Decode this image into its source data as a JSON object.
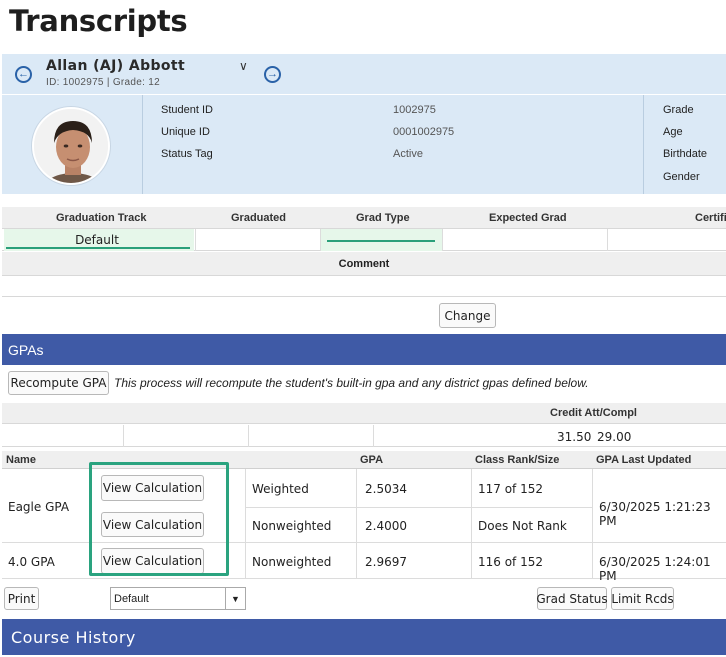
{
  "page_title": "Transcripts",
  "student": {
    "name": "Allan (AJ) Abbott",
    "sub": "ID: 1002975 |  Grade: 12",
    "fields_left": [
      {
        "label": "Student ID",
        "value": "1002975"
      },
      {
        "label": "Unique ID",
        "value": "0001002975"
      },
      {
        "label": "Status Tag",
        "value": "Active"
      }
    ],
    "fields_right": [
      "Grade",
      "Age",
      "Birthdate",
      "Gender"
    ]
  },
  "graduation": {
    "headers": [
      "Graduation Track",
      "Graduated",
      "Grad Type",
      "Expected Grad",
      "Certifi"
    ],
    "track_value": "Default",
    "comment_header": "Comment",
    "change_label": "Change"
  },
  "gpas": {
    "section_title": "GPAs",
    "recompute_label": "Recompute GPA",
    "note": "This process will recompute the student's built-in gpa and any district gpas defined below.",
    "credit_header": "Credit Att/Compl",
    "credit_attempted": "31.50",
    "credit_completed": "29.00",
    "columns": {
      "name": "Name",
      "gpa": "GPA",
      "rank": "Class Rank/Size",
      "updated": "GPA Last Updated"
    },
    "view_label": "View Calculation",
    "rows": [
      {
        "name": "Eagle GPA",
        "type": "Weighted",
        "gpa": "2.5034",
        "rank": "117 of 152",
        "updated": "6/30/2025 1:21:23 PM"
      },
      {
        "name": "",
        "type": "Nonweighted",
        "gpa": "2.4000",
        "rank": "Does Not Rank",
        "updated": ""
      },
      {
        "name": "4.0 GPA",
        "type": "Nonweighted",
        "gpa": "2.9697",
        "rank": "116 of 152",
        "updated": "6/30/2025 1:24:01 PM"
      }
    ]
  },
  "footer": {
    "print_label": "Print",
    "select_value": "Default",
    "grad_status_label": "Grad Status",
    "limit_label": "Limit Rcds"
  },
  "course_history_title": "Course History",
  "colors": {
    "accent": "#3f5aa6",
    "panel": "#dbe9f6",
    "highlight": "#2aa37f"
  }
}
